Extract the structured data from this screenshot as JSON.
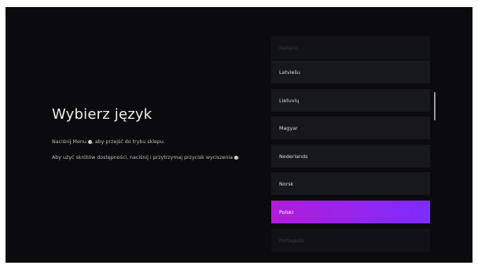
{
  "heading": "Wybierz język",
  "instructions": {
    "store_mode": {
      "before": "Naciśnij Menu",
      "after": ", aby przejść do trybu sklepu."
    },
    "accessibility": {
      "before": "Aby użyć skrótów dostępności, naciśnij i przytrzymaj przycisk wyciszenia",
      "after": "."
    }
  },
  "languages": [
    {
      "label": "Italiano",
      "state": "faded"
    },
    {
      "label": "Latviešu",
      "state": "normal"
    },
    {
      "label": "Lietuvių",
      "state": "normal"
    },
    {
      "label": "Magyar",
      "state": "normal"
    },
    {
      "label": "Nederlands",
      "state": "normal"
    },
    {
      "label": "Norsk",
      "state": "normal"
    },
    {
      "label": "Polski",
      "state": "selected"
    },
    {
      "label": "Português",
      "state": "faded"
    }
  ],
  "colors": {
    "background": "#0b0b0f",
    "item": "#17181c",
    "selected_start": "#b11dd8",
    "selected_end": "#7d2cff"
  },
  "icons": {
    "menu_button": "menu-button-icon",
    "mute_button": "mute-button-icon"
  }
}
